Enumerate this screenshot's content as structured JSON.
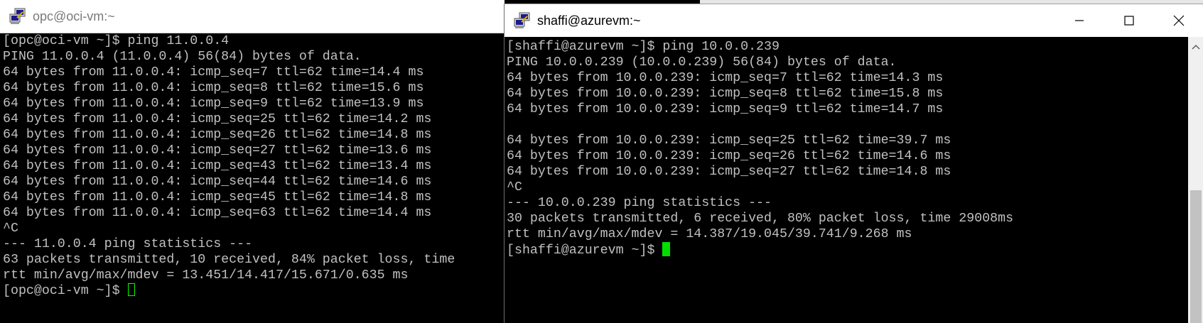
{
  "left_window": {
    "title": "opc@oci-vm:~",
    "lines": [
      "[opc@oci-vm ~]$ ping 11.0.0.4",
      "PING 11.0.0.4 (11.0.0.4) 56(84) bytes of data.",
      "64 bytes from 11.0.0.4: icmp_seq=7 ttl=62 time=14.4 ms",
      "64 bytes from 11.0.0.4: icmp_seq=8 ttl=62 time=15.6 ms",
      "64 bytes from 11.0.0.4: icmp_seq=9 ttl=62 time=13.9 ms",
      "64 bytes from 11.0.0.4: icmp_seq=25 ttl=62 time=14.2 ms",
      "64 bytes from 11.0.0.4: icmp_seq=26 ttl=62 time=14.8 ms",
      "64 bytes from 11.0.0.4: icmp_seq=27 ttl=62 time=13.6 ms",
      "64 bytes from 11.0.0.4: icmp_seq=43 ttl=62 time=13.4 ms",
      "64 bytes from 11.0.0.4: icmp_seq=44 ttl=62 time=14.6 ms",
      "64 bytes from 11.0.0.4: icmp_seq=45 ttl=62 time=14.8 ms",
      "64 bytes from 11.0.0.4: icmp_seq=63 ttl=62 time=14.4 ms",
      "^C",
      "--- 11.0.0.4 ping statistics ---",
      "63 packets transmitted, 10 received, 84% packet loss, time",
      "rtt min/avg/max/mdev = 13.451/14.417/15.671/0.635 ms"
    ],
    "prompt": "[opc@oci-vm ~]$ "
  },
  "right_window": {
    "title": "shaffi@azurevm:~",
    "lines": [
      "[shaffi@azurevm ~]$ ping 10.0.0.239",
      "PING 10.0.0.239 (10.0.0.239) 56(84) bytes of data.",
      "64 bytes from 10.0.0.239: icmp_seq=7 ttl=62 time=14.3 ms",
      "64 bytes from 10.0.0.239: icmp_seq=8 ttl=62 time=15.8 ms",
      "64 bytes from 10.0.0.239: icmp_seq=9 ttl=62 time=14.7 ms",
      "",
      "64 bytes from 10.0.0.239: icmp_seq=25 ttl=62 time=39.7 ms",
      "64 bytes from 10.0.0.239: icmp_seq=26 ttl=62 time=14.6 ms",
      "64 bytes from 10.0.0.239: icmp_seq=27 ttl=62 time=14.8 ms",
      "^C",
      "--- 10.0.0.239 ping statistics ---",
      "30 packets transmitted, 6 received, 80% packet loss, time 29008ms",
      "rtt min/avg/max/mdev = 14.387/19.045/39.741/9.268 ms"
    ],
    "prompt": "[shaffi@azurevm ~]$ "
  },
  "icons": {
    "app": "putty-icon",
    "minimize": "minimize-icon",
    "maximize": "maximize-icon",
    "close": "close-icon"
  },
  "colors": {
    "terminal_bg": "#000000",
    "terminal_fg": "#c0c0c0",
    "cursor": "#00ff00"
  }
}
